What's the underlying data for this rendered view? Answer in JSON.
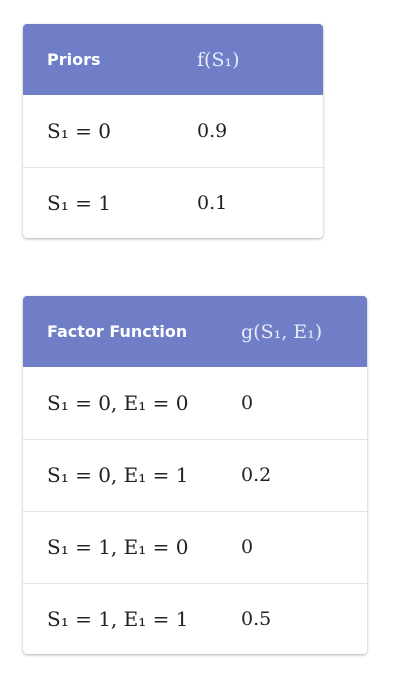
{
  "priors_table": {
    "headers": [
      "Priors",
      "f(S₁)"
    ],
    "rows": [
      {
        "condition": "S₁ = 0",
        "value": "0.9"
      },
      {
        "condition": "S₁ = 1",
        "value": "0.1"
      }
    ]
  },
  "factor_table": {
    "headers": [
      "Factor Function",
      "g(S₁, E₁)"
    ],
    "rows": [
      {
        "condition": "S₁ = 0, E₁ = 0",
        "value": "0"
      },
      {
        "condition": "S₁ = 0, E₁ = 1",
        "value": "0.2"
      },
      {
        "condition": "S₁ = 1, E₁ = 0",
        "value": "0"
      },
      {
        "condition": "S₁ = 1, E₁ = 1",
        "value": "0.5"
      }
    ]
  },
  "colors": {
    "header_bg": "#6f7ec6",
    "header_text": "#ffffff",
    "divider": "#e3e3e3"
  }
}
